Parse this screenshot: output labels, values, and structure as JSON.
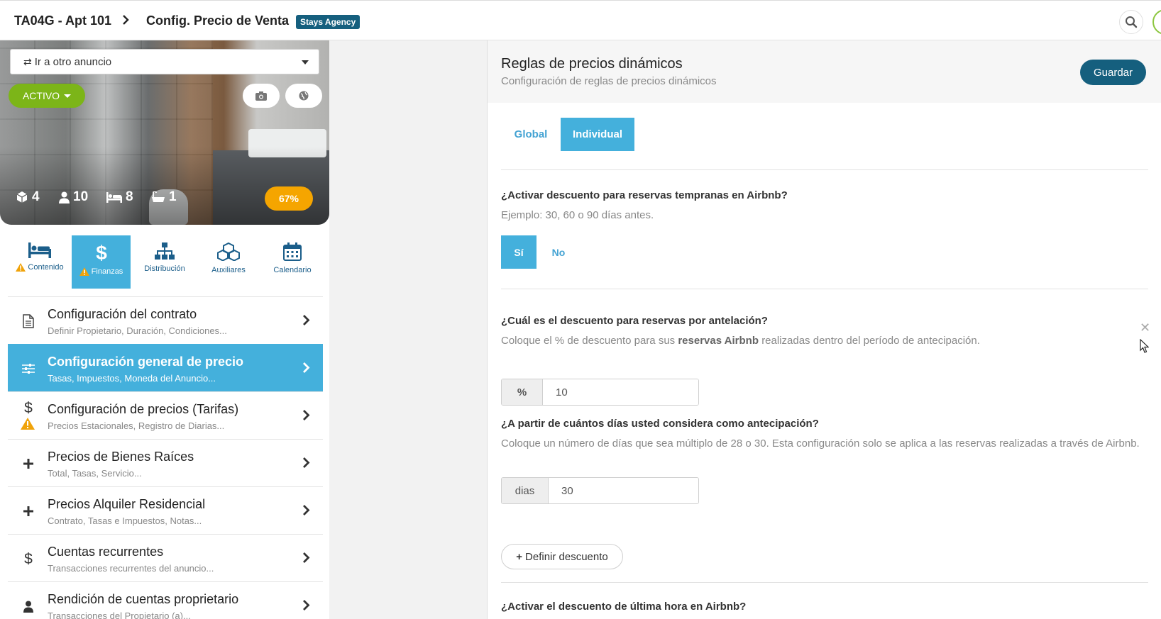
{
  "header": {
    "breadcrumb_listing": "TA04G - Apt 101",
    "breadcrumb_page": "Config. Precio de Venta",
    "agency_badge": "Stays Agency"
  },
  "listing": {
    "select_placeholder": "Ir a otro anuncio",
    "status": "ACTIVO",
    "stats": {
      "rooms": "4",
      "guests": "10",
      "beds": "8",
      "baths": "1"
    },
    "completion": "67%"
  },
  "tabs": [
    {
      "label": "Contenido",
      "warning": true
    },
    {
      "label": "Finanzas",
      "warning": true,
      "active": true
    },
    {
      "label": "Distribución"
    },
    {
      "label": "Auxiliares"
    },
    {
      "label": "Calendario"
    }
  ],
  "menu": [
    {
      "title": "Configuración del contrato",
      "sub": "Definir Propietario, Duración, Condiciones...",
      "icon": "document-icon"
    },
    {
      "title": "Configuración general de precio",
      "sub": "Tasas, Impuestos, Moneda del Anuncio...",
      "icon": "sliders-icon",
      "active": true
    },
    {
      "title": "Configuración de precios (Tarifas)",
      "sub": "Precios Estacionales, Registro de Diarias...",
      "icon": "dollar-icon",
      "warning": true
    },
    {
      "title": "Precios de Bienes Raíces",
      "sub": "Total, Tasas, Servicio...",
      "icon": "plus-icon"
    },
    {
      "title": "Precios Alquiler Residencial",
      "sub": "Contrato, Tasas e Impuestos, Notas...",
      "icon": "plus-icon"
    },
    {
      "title": "Cuentas recurrentes",
      "sub": "Transacciones recurrentes del anuncio...",
      "icon": "dollar-icon"
    },
    {
      "title": "Rendición de cuentas proprietario",
      "sub": "Transacciones del Propietario (a)...",
      "icon": "user-icon"
    }
  ],
  "panel": {
    "title": "Reglas de precios dinámicos",
    "subtitle": "Configuración de reglas de precios dinámicos",
    "save_label": "Guardar",
    "scope_tabs": {
      "global": "Global",
      "individual": "Individual",
      "selected": "Individual"
    },
    "q1": {
      "title": "¿Activar descuento para reservas tempranas en Airbnb?",
      "help": "Ejemplo: 30, 60 o 90 días antes.",
      "yes": "Sí",
      "no": "No",
      "selected": "Sí"
    },
    "q2": {
      "title": "¿Cuál es el descuento para reservas por antelación?",
      "help_before": "Coloque el % de descuento para sus",
      "help_bold": "reservas Airbnb",
      "help_after": "realizadas dentro del período de antecipación.",
      "addon": "%",
      "value": "10"
    },
    "q3": {
      "title": "¿A partir de cuántos días usted considera como antecipación?",
      "help": "Coloque un número de días que sea múltiplo de 28 o 30. Esta configuración solo se aplica a las reservas realizadas a través de Airbnb.",
      "addon": "dias",
      "value": "30"
    },
    "define_label": "Definir descuento",
    "q4": {
      "title": "¿Activar el descuento de última hora en Airbnb?"
    }
  },
  "colors": {
    "accent": "#44b0dc",
    "primary_dark": "#155f7e",
    "status_green": "#7cb518",
    "badge_orange": "#f5a500",
    "warning": "#f0a30a"
  }
}
